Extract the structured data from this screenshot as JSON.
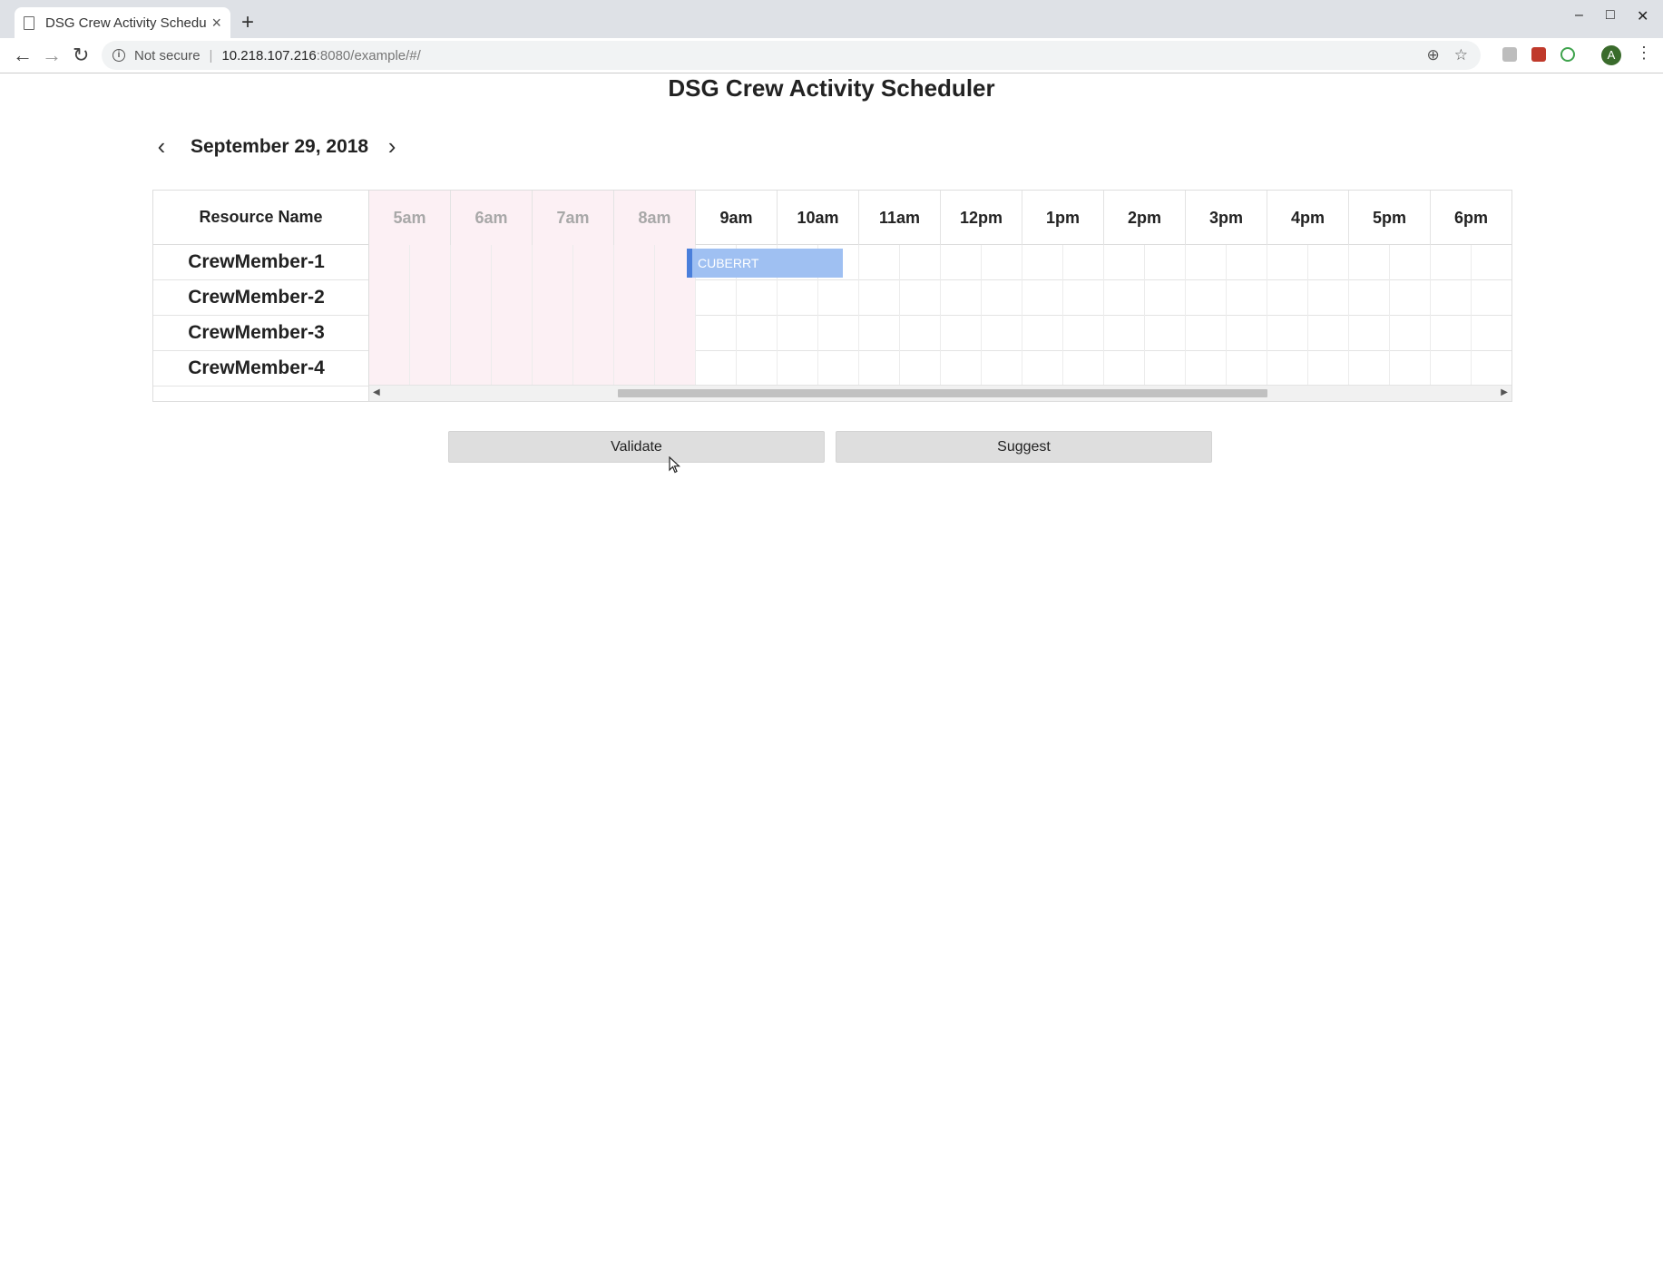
{
  "browser": {
    "tab_title": "DSG Crew Activity Schedu",
    "tab_close": "×",
    "new_tab": "+",
    "window_controls": [
      "–",
      "□",
      "✕"
    ],
    "nav": {
      "back": "←",
      "forward": "→",
      "reload": "↻"
    },
    "security_label": "Not secure",
    "url_host": "10.218.107.216",
    "url_path": ":8080/example/#/",
    "profile_initial": "A"
  },
  "page": {
    "title": "DSG Crew Activity Scheduler"
  },
  "date_nav": {
    "prev": "‹",
    "next": "›",
    "date": "September 29, 2018"
  },
  "scheduler": {
    "resource_header": "Resource Name",
    "hours": [
      {
        "label": "5am",
        "off_hours": true
      },
      {
        "label": "6am",
        "off_hours": true
      },
      {
        "label": "7am",
        "off_hours": true
      },
      {
        "label": "8am",
        "off_hours": true
      },
      {
        "label": "9am",
        "off_hours": false
      },
      {
        "label": "10am",
        "off_hours": false
      },
      {
        "label": "11am",
        "off_hours": false
      },
      {
        "label": "12pm",
        "off_hours": false
      },
      {
        "label": "1pm",
        "off_hours": false
      },
      {
        "label": "2pm",
        "off_hours": false
      },
      {
        "label": "3pm",
        "off_hours": false
      },
      {
        "label": "4pm",
        "off_hours": false
      },
      {
        "label": "5pm",
        "off_hours": false
      },
      {
        "label": "6pm",
        "off_hours": false
      }
    ],
    "resources": [
      "CrewMember-1",
      "CrewMember-2",
      "CrewMember-3",
      "CrewMember-4"
    ],
    "events": [
      {
        "label": "CUBERRT",
        "resource": "CrewMember-1",
        "start": "9am",
        "end": "11am",
        "color": "#9fc0f2",
        "accent": "#4a7fdb"
      }
    ],
    "off_hours_color": "#fcf0f4"
  },
  "actions": {
    "validate_label": "Validate",
    "suggest_label": "Suggest"
  }
}
